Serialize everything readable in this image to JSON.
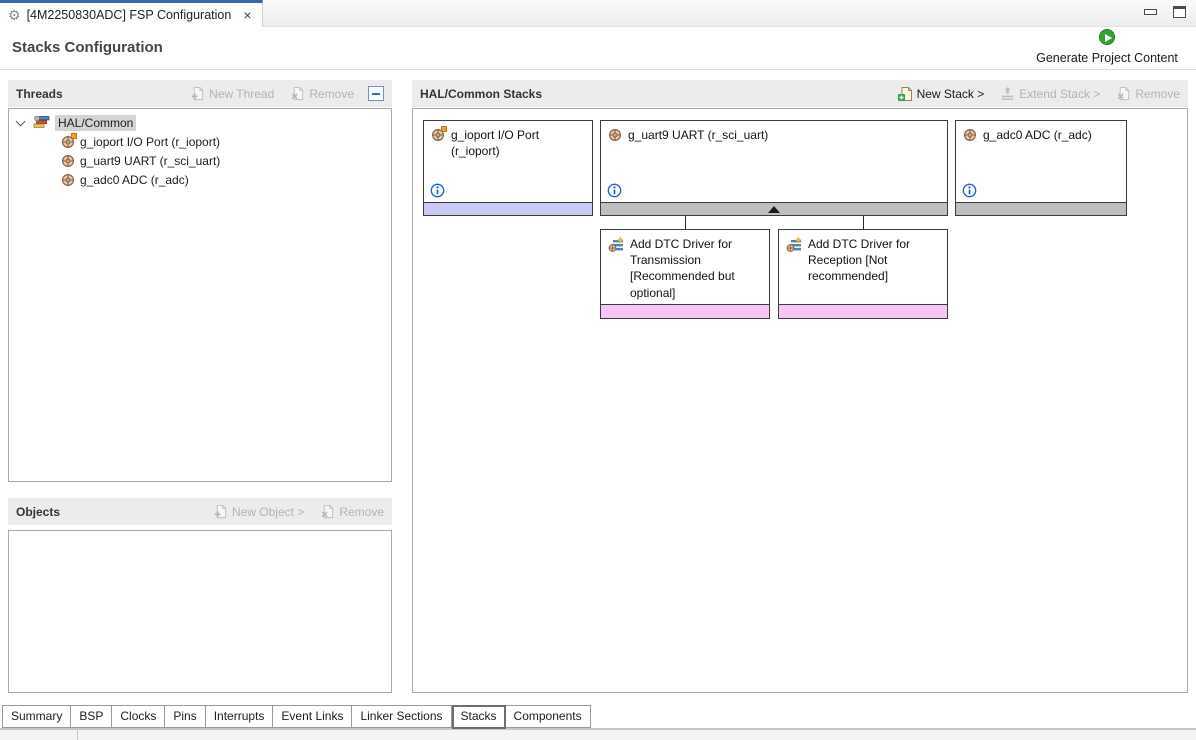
{
  "editor_tab": {
    "title": "[4M2250830ADC] FSP Configuration",
    "close": "×"
  },
  "header": {
    "title": "Stacks Configuration",
    "generate_label": "Generate Project Content"
  },
  "threads_panel": {
    "title": "Threads",
    "actions": {
      "new_thread": "New Thread",
      "remove": "Remove"
    },
    "tree": {
      "root": "HAL/Common",
      "children": [
        "g_ioport I/O Port (r_ioport)",
        "g_uart9 UART (r_sci_uart)",
        "g_adc0 ADC (r_adc)"
      ]
    }
  },
  "objects_panel": {
    "title": "Objects",
    "actions": {
      "new_object": "New Object >",
      "remove": "Remove"
    }
  },
  "stacks_panel": {
    "title": "HAL/Common Stacks",
    "actions": {
      "new_stack": "New Stack >",
      "extend_stack": "Extend Stack >",
      "remove": "Remove"
    },
    "cards": [
      {
        "title": "g_ioport I/O Port (r_ioport)"
      },
      {
        "title": "g_uart9 UART (r_sci_uart)"
      },
      {
        "title": "g_adc0 ADC (r_adc)"
      }
    ],
    "child_cards": [
      {
        "title": "Add DTC Driver for Transmission [Recommended but optional]"
      },
      {
        "title": "Add DTC Driver for Reception [Not recommended]"
      }
    ]
  },
  "bottom_tabs": [
    "Summary",
    "BSP",
    "Clocks",
    "Pins",
    "Interrupts",
    "Event Links",
    "Linker Sections",
    "Stacks",
    "Components"
  ],
  "colors": {
    "tab_accent_blue": "#3665b3",
    "strip_lavender": "#c9c9f8",
    "strip_gray": "#bfbfbf",
    "strip_pink": "#f6c6f6",
    "generate_green": "#35a435",
    "info_blue": "#1565c0"
  }
}
